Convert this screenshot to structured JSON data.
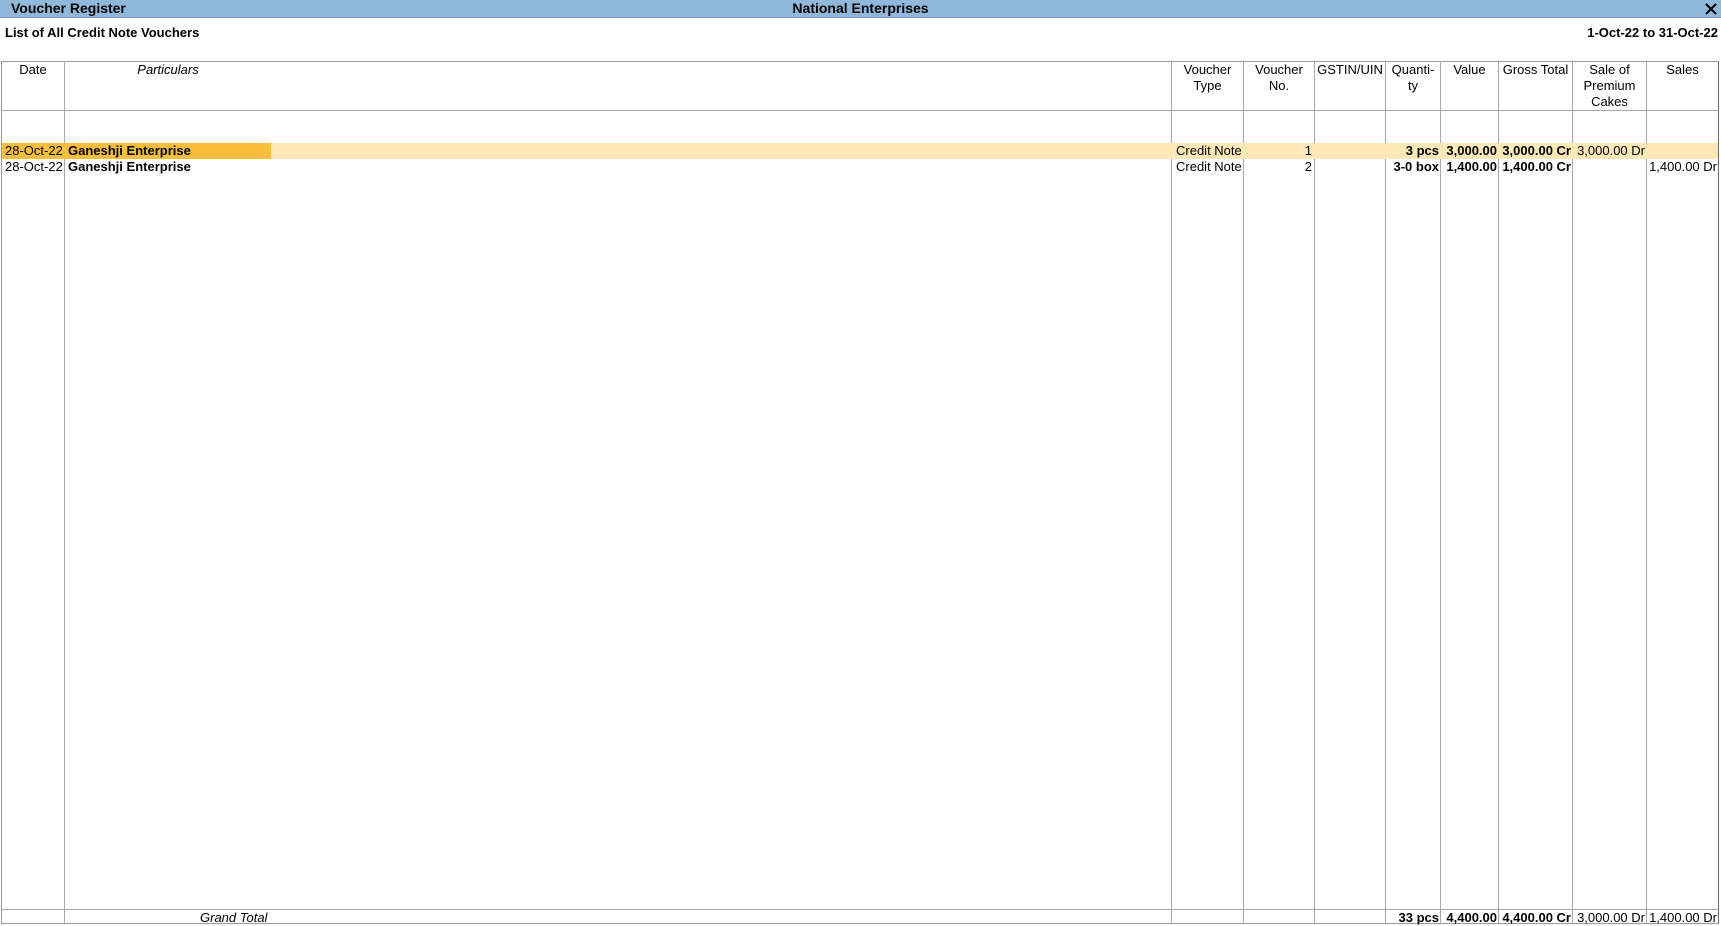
{
  "window": {
    "title": "Voucher Register",
    "company": "National Enterprises"
  },
  "report": {
    "title": "List of All Credit Note Vouchers",
    "period": "1-Oct-22 to 31-Oct-22"
  },
  "columns": {
    "date": "Date",
    "particulars": "Particulars",
    "voucher_type_1": "Voucher",
    "voucher_type_2": "Type",
    "voucher_no_1": "Voucher",
    "voucher_no_2": "No.",
    "gstin": "GSTIN/UIN",
    "quantity_1": "Quanti-",
    "quantity_2": "ty",
    "value": "Value",
    "gross_total": "Gross Total",
    "sale_premium_1": "Sale of",
    "sale_premium_2": "Premium",
    "sale_premium_3": "Cakes",
    "sales": "Sales"
  },
  "rows": [
    {
      "date": "28-Oct-22",
      "particulars": "Ganeshji Enterprise",
      "voucher_type": "Credit Note",
      "voucher_no": "1",
      "gstin": "",
      "quantity": "3 pcs",
      "value": "3,000.00",
      "gross_total": "3,000.00 Cr",
      "sale_premium": "3,000.00 Dr",
      "sales": ""
    },
    {
      "date": "28-Oct-22",
      "particulars": "Ganeshji Enterprise",
      "voucher_type": "Credit Note",
      "voucher_no": "2",
      "gstin": "",
      "quantity": "3-0 box",
      "value": "1,400.00",
      "gross_total": "1,400.00 Cr",
      "sale_premium": "",
      "sales": "1,400.00 Dr"
    }
  ],
  "totals": {
    "label": "Grand Total",
    "quantity": "33 pcs",
    "value": "4,400.00",
    "gross_total": "4,400.00 Cr",
    "sale_premium": "3,000.00 Dr",
    "sales": "1,400.00 Dr"
  },
  "colors": {
    "titlebar": "#8fb8db",
    "selected_row": "#fde9b8",
    "selected_cell": "#f8be3c"
  },
  "icons": {
    "close": "close-icon"
  }
}
